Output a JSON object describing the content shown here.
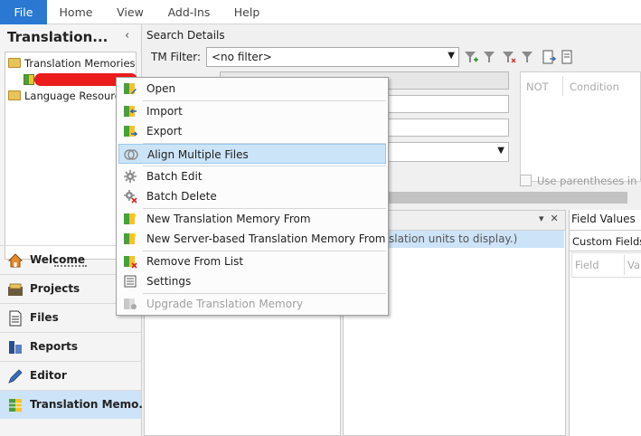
{
  "ribbon": {
    "tabs": [
      {
        "label": "File",
        "active": true
      },
      {
        "label": "Home"
      },
      {
        "label": "View"
      },
      {
        "label": "Add-Ins"
      },
      {
        "label": "Help"
      }
    ]
  },
  "nav": {
    "title": "Translation...",
    "collapse_glyph": "‹",
    "tree": {
      "root1": "Translation Memories",
      "root2": "Language Resource"
    },
    "buttons": [
      {
        "label": "Welcome",
        "icon": "home-icon"
      },
      {
        "label": "Projects",
        "icon": "projects-icon"
      },
      {
        "label": "Files",
        "icon": "files-icon"
      },
      {
        "label": "Reports",
        "icon": "reports-icon"
      },
      {
        "label": "Editor",
        "icon": "editor-icon"
      },
      {
        "label": "Translation Memo...",
        "icon": "translation-memory-icon",
        "active": true
      }
    ]
  },
  "search": {
    "title": "Search Details",
    "filter_label": "TM Filter:",
    "filter_value": "<no filter>",
    "condition_headers": [
      "NOT",
      "Condition"
    ],
    "parentheses_label": "Use parentheses in thi"
  },
  "results": {
    "message": "slation units to display.)"
  },
  "field_values": {
    "header": "Field Values",
    "custom_fields": "Custom Fields",
    "col_field": "Field",
    "col_value": "Va"
  },
  "context_menu": {
    "items": [
      {
        "label": "Open",
        "icon": "open-icon"
      },
      {
        "label": "Import",
        "icon": "import-icon"
      },
      {
        "label": "Export",
        "icon": "export-icon"
      },
      {
        "label": "Align Multiple Files",
        "icon": "align-files-icon",
        "highlighted": true
      },
      {
        "label": "Batch Edit",
        "icon": "batch-edit-icon"
      },
      {
        "label": "Batch Delete",
        "icon": "batch-delete-icon"
      },
      {
        "label": "New Translation Memory From",
        "icon": "new-tm-icon"
      },
      {
        "label": "New Server-based Translation Memory From",
        "icon": "new-server-tm-icon"
      },
      {
        "label": "Remove From List",
        "icon": "remove-icon"
      },
      {
        "label": "Settings",
        "icon": "settings-icon"
      },
      {
        "label": "Upgrade Translation Memory",
        "icon": "upgrade-icon",
        "disabled": true
      }
    ]
  },
  "colors": {
    "accent": "#2a78d1",
    "selection": "#cde3f7",
    "redaction": "#ea1c1c"
  }
}
